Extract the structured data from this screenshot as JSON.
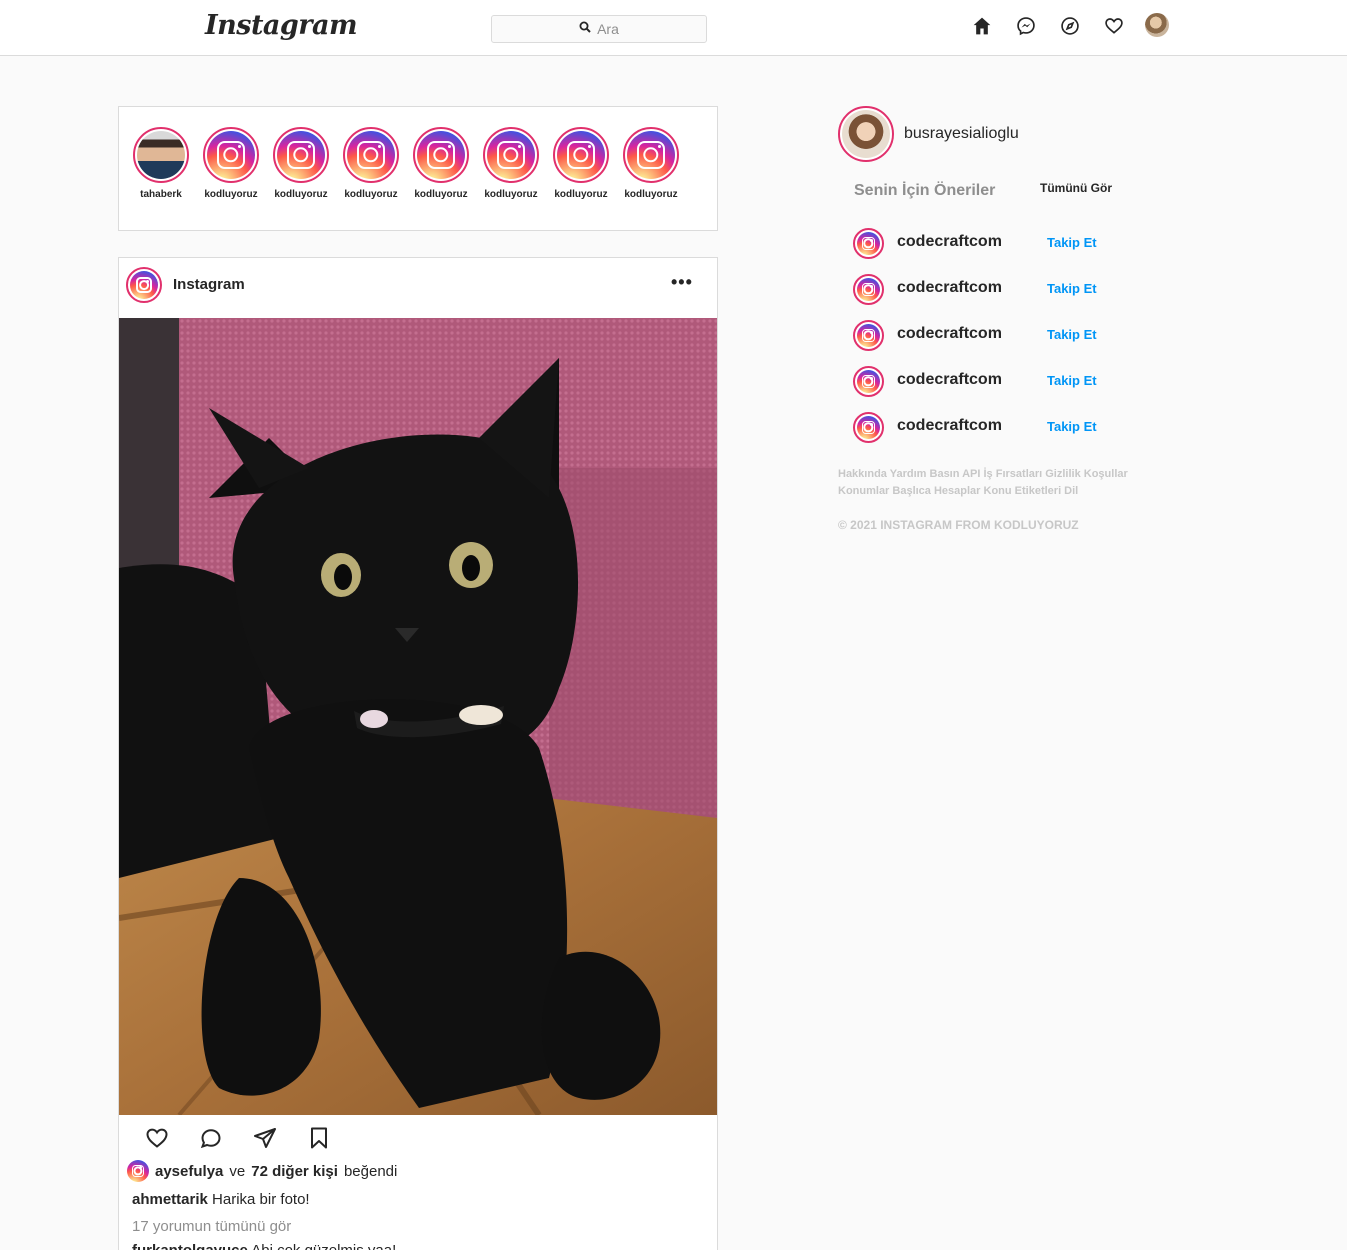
{
  "header": {
    "logo": "Instagram",
    "search_placeholder": "Ara"
  },
  "stories": [
    {
      "label": "tahaberk",
      "avatar": "person"
    },
    {
      "label": "kodluyoruz",
      "avatar": "instagram-logo"
    },
    {
      "label": "kodluyoruz",
      "avatar": "instagram-logo"
    },
    {
      "label": "kodluyoruz",
      "avatar": "instagram-logo"
    },
    {
      "label": "kodluyoruz",
      "avatar": "instagram-logo"
    },
    {
      "label": "kodluyoruz",
      "avatar": "instagram-logo"
    },
    {
      "label": "kodluyoruz",
      "avatar": "instagram-logo"
    },
    {
      "label": "kodluyoruz",
      "avatar": "instagram-logo"
    }
  ],
  "post": {
    "username": "Instagram",
    "more": "•••",
    "image": "black-kitten-photo",
    "likes": {
      "user": "aysefulya",
      "connector": "ve",
      "others": "72 diğer kişi",
      "suffix": "beğendi"
    },
    "caption": {
      "user": "ahmettarik",
      "text": "Harika bir foto!"
    },
    "view_comments": "17 yorumun tümünü gör",
    "comment": {
      "user": "furkantolgayuce",
      "text": "Abi çok güzelmiş yaa!"
    }
  },
  "sidebar": {
    "username": "busrayesialioglu",
    "suggestions_title": "Senin İçin Öneriler",
    "see_all": "Tümünü Gör",
    "suggestions": [
      {
        "name": "codecraftcom",
        "action": "Takip Et"
      },
      {
        "name": "codecraftcom",
        "action": "Takip Et"
      },
      {
        "name": "codecraftcom",
        "action": "Takip Et"
      },
      {
        "name": "codecraftcom",
        "action": "Takip Et"
      },
      {
        "name": "codecraftcom",
        "action": "Takip Et"
      }
    ],
    "footer_line1": "Hakkında Yardım Basın API İş Fırsatları Gizlilik Koşullar",
    "footer_line2": "Konumlar Başlıca Hesaplar Konu Etiketleri Dil",
    "copyright": "© 2021 INSTAGRAM FROM KODLUYORUZ"
  },
  "colors": {
    "accent": "#0095f6",
    "ring": "#e1306c",
    "border": "#dbdbdb",
    "muted": "#8e8e8e"
  }
}
